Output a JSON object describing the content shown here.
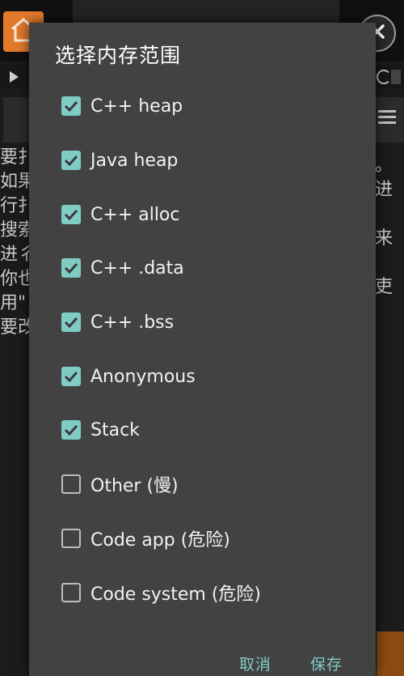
{
  "dialog": {
    "title": "选择内存范围",
    "options": [
      {
        "label": "C++ heap",
        "checked": true
      },
      {
        "label": "Java heap",
        "checked": true
      },
      {
        "label": "C++ alloc",
        "checked": true
      },
      {
        "label": "C++ .data",
        "checked": true
      },
      {
        "label": "C++ .bss",
        "checked": true
      },
      {
        "label": "Anonymous",
        "checked": true
      },
      {
        "label": "Stack",
        "checked": true
      },
      {
        "label": "Other (慢)",
        "checked": false
      },
      {
        "label": "Code app (危险)",
        "checked": false
      },
      {
        "label": "Code system (危险)",
        "checked": false
      }
    ],
    "cancel_label": "取消",
    "save_label": "保存"
  },
  "background": {
    "left_text": "要扌\n如果\n行扌\n搜索\n进彳\n你也\n用\"\n要改",
    "right_text": "。\n进\n\n来\n\n吏"
  },
  "colors": {
    "accent": "#80cbc4",
    "dialog_bg": "#424242",
    "home_button": "#e27a2c"
  },
  "icons": [
    "home-icon",
    "close-icon",
    "play-icon",
    "refresh-icon",
    "menu-icon",
    "checkmark-icon"
  ]
}
